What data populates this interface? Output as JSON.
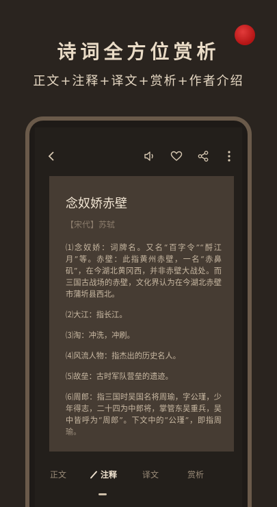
{
  "promo": {
    "title": "诗词全方位赏析",
    "subtitle": "正文+注释+译文+赏析+作者介绍"
  },
  "toolbar": {
    "back_icon": "chevron-left-icon",
    "actions": [
      "speaker-icon",
      "heart-icon",
      "share-icon",
      "more-vertical-icon"
    ]
  },
  "poem": {
    "title": "念奴娇赤壁",
    "author": "【宋代】苏轼",
    "notes": [
      "⑴念奴娇：词牌名。又名“百字令”“酹江月”等。赤壁：此指黄州赤壁，一名“赤鼻矶”，在今湖北黄冈西，并非赤壁大战处。而三国古战场的赤壁，文化界认为在今湖北赤壁市蒲圻县西北。",
      "⑵大江：指长江。",
      "⑶淘：冲洗，冲刷。",
      "⑷风流人物：指杰出的历史名人。",
      "⑸故垒：古时军队营垒的遗迹。",
      "⑹周郎：指三国时吴国名将周瑜，字公瑾，少年得志，二十四为中郎将，掌管东吴重兵，吴中皆呼为“周郎”。下文中的“公瑾”，即指周瑜。"
    ]
  },
  "tabs": [
    {
      "label": "正文",
      "active": false
    },
    {
      "label": "注释",
      "active": true
    },
    {
      "label": "译文",
      "active": false
    },
    {
      "label": "赏析",
      "active": false
    }
  ],
  "colors": {
    "background": "#2a241f",
    "card": "#463c33",
    "seal": "#c41e1e",
    "text_light": "#eadcc7"
  }
}
